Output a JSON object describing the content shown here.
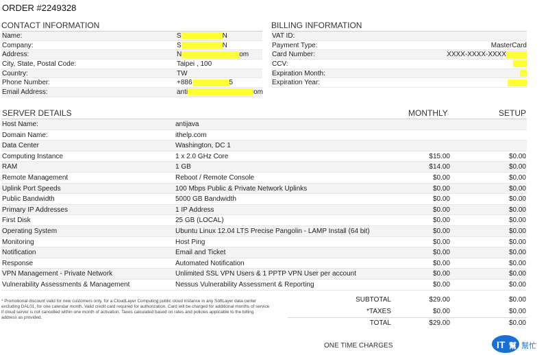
{
  "order_title": "ORDER #2249328",
  "contact": {
    "heading": "CONTACT INFORMATION",
    "rows": [
      {
        "label": "Name:",
        "value": "S",
        "value_end": "N"
      },
      {
        "label": "Company:",
        "value": "S",
        "value_end": "N"
      },
      {
        "label": "Address:",
        "value": "N",
        "value_end": "om"
      },
      {
        "label": "City, State, Postal Code:",
        "value": "Taipei , 100",
        "value_end": ""
      },
      {
        "label": "Country:",
        "value": "TW",
        "value_end": ""
      },
      {
        "label": "Phone Number:",
        "value": "+886",
        "value_end": "5"
      },
      {
        "label": "Email Address:",
        "value": "anti",
        "value_end": "om"
      }
    ]
  },
  "billing": {
    "heading": "BILLING INFORMATION",
    "rows": [
      {
        "label": "VAT ID:",
        "value": ""
      },
      {
        "label": "Payment Type:",
        "value": "MasterCard"
      },
      {
        "label": "Card Number:",
        "value": "XXXX-XXXX-XXXX"
      },
      {
        "label": "CCV:",
        "value": ""
      },
      {
        "label": "Expiration Month:",
        "value": ""
      },
      {
        "label": "Expiration Year:",
        "value": ""
      }
    ]
  },
  "server": {
    "heading": "SERVER DETAILS",
    "col_monthly": "MONTHLY",
    "col_setup": "SETUP",
    "rows": [
      {
        "label": "Host Name:",
        "value": "antijava",
        "monthly": "",
        "setup": ""
      },
      {
        "label": "Domain Name:",
        "value": "ithelp.com",
        "monthly": "",
        "setup": ""
      },
      {
        "label": "Data Center",
        "value": "Washington, DC 1",
        "monthly": "",
        "setup": ""
      },
      {
        "label": "Computing Instance",
        "value": "1 x 2.0 GHz Core",
        "monthly": "$15.00",
        "setup": "$0.00"
      },
      {
        "label": "RAM",
        "value": "1 GB",
        "monthly": "$14.00",
        "setup": "$0.00"
      },
      {
        "label": "Remote Management",
        "value": "Reboot / Remote Console",
        "monthly": "$0.00",
        "setup": "$0.00"
      },
      {
        "label": "Uplink Port Speeds",
        "value": "100 Mbps Public & Private Network Uplinks",
        "monthly": "$0.00",
        "setup": "$0.00"
      },
      {
        "label": "Public Bandwidth",
        "value": "5000 GB Bandwidth",
        "monthly": "$0.00",
        "setup": "$0.00"
      },
      {
        "label": "Primary IP Addresses",
        "value": "1 IP Address",
        "monthly": "$0.00",
        "setup": "$0.00"
      },
      {
        "label": "First Disk",
        "value": "25 GB (LOCAL)",
        "monthly": "$0.00",
        "setup": "$0.00"
      },
      {
        "label": "Operating System",
        "value": "Ubuntu Linux 12.04 LTS Precise Pangolin - LAMP Install (64 bit)",
        "monthly": "$0.00",
        "setup": "$0.00"
      },
      {
        "label": "Monitoring",
        "value": "Host Ping",
        "monthly": "$0.00",
        "setup": "$0.00"
      },
      {
        "label": "Notification",
        "value": "Email and Ticket",
        "monthly": "$0.00",
        "setup": "$0.00"
      },
      {
        "label": "Response",
        "value": "Automated Notification",
        "monthly": "$0.00",
        "setup": "$0.00"
      },
      {
        "label": "VPN Management - Private Network",
        "value": "Unlimited SSL VPN Users & 1 PPTP VPN User per account",
        "monthly": "$0.00",
        "setup": "$0.00"
      },
      {
        "label": "Vulnerability Assessments & Management",
        "value": "Nessus Vulnerability Assessment & Reporting",
        "monthly": "$0.00",
        "setup": "$0.00"
      }
    ]
  },
  "footnote": "* Promotional discount valid for new customers only, for a CloudLayer Computing public cloud instance in any SoftLayer data center excluding DAL01, for one calendar month. Valid credit card required for authorization. Card will be charged for additional months of service if cloud server is not cancelled within one month of activation. Taxes calculated based on rates and policies applicable to the billing address as provided.",
  "totals": [
    {
      "label": "SUBTOTAL",
      "monthly": "$29.00",
      "setup": "$0.00"
    },
    {
      "label": "*TAXES",
      "monthly": "$0.00",
      "setup": "$0.00"
    },
    {
      "label": "TOTAL",
      "monthly": "$29.00",
      "setup": "$0.00"
    }
  ],
  "one_time_charges": "ONE TIME CHARGES",
  "logo": {
    "text_it": "IT",
    "text_cn": "幫",
    "text_side": "幫忙",
    "color": "#1a6fd4"
  },
  "colors": {
    "redaction": "#ffff33",
    "row_alt": "#f3f3f3"
  }
}
